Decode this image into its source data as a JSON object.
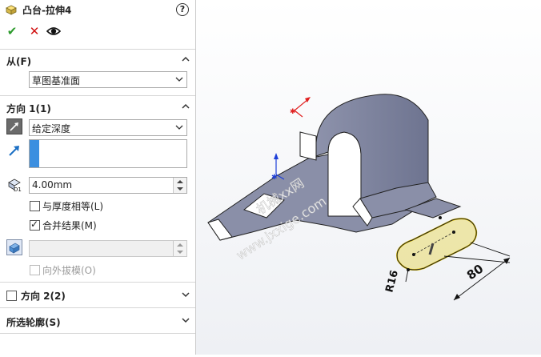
{
  "panel": {
    "title": "凸台-拉伸4",
    "help": "?",
    "actions": {
      "ok": "✔",
      "cancel": "✕",
      "preview": "👁"
    },
    "from": {
      "label": "从(F)",
      "value": "草图基准面"
    },
    "direction1": {
      "label": "方向 1(1)",
      "end_condition": "给定深度",
      "depth": "4.00mm",
      "thicken_label": "与厚度相等(L)",
      "thicken_checked": false,
      "merge_label": "合并结果(M)",
      "merge_checked": true,
      "draft_value": "",
      "draft_outward_label": "向外拔模(O)"
    },
    "direction2": {
      "label": "方向 2(2)",
      "checked": false
    },
    "selected_contours": {
      "label": "所选轮廓(S)"
    }
  },
  "viewport": {
    "dim_radius": "R16",
    "dim_length": "80",
    "watermark": "www.jxxige.com",
    "watermark_prefix": "机械xx网",
    "colors": {
      "part": "#8a8fa8",
      "selection": "#e8d96a",
      "axis_x": "#e02020",
      "axis_y": "#1e3fd8"
    }
  }
}
